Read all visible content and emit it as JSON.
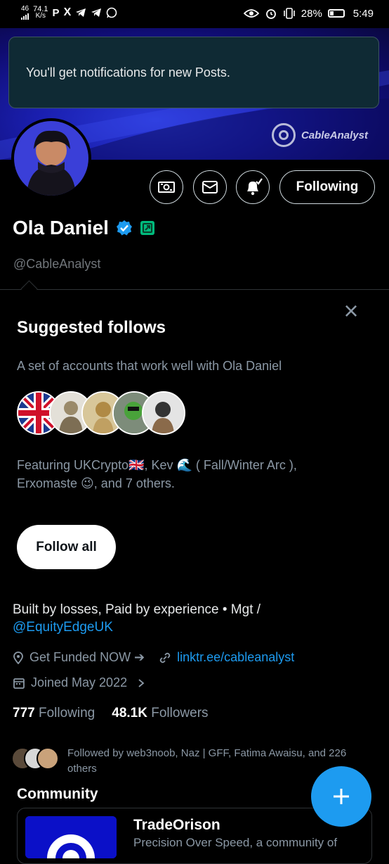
{
  "status_bar": {
    "network_top": "46",
    "network_bottom": "all",
    "speed_value": "74.1",
    "speed_unit": "K/s",
    "battery": "28%",
    "time": "5:49",
    "left_icons": [
      "signal-icon",
      "pinterest-icon",
      "x-icon",
      "telegram-icon",
      "telegram-icon",
      "telegram-icon",
      "whatsapp-icon"
    ],
    "right_icons": [
      "eye-icon",
      "alarm-icon",
      "vibrate-icon",
      "battery-icon"
    ]
  },
  "toast": {
    "message": "You'll get notifications for new Posts."
  },
  "banner": {
    "brand_text": "CableAnalyst"
  },
  "profile": {
    "name": "Ola Daniel",
    "handle": "@CableAnalyst",
    "following_button": "Following",
    "bio_text": "Built by losses, Paid by experience • Mgt /",
    "bio_mention": "@EquityEdgeUK",
    "location": "Get Funded NOW ➔",
    "website": "linktr.ee/cableanalyst",
    "joined": "Joined May 2022",
    "following_count": "777",
    "following_label": "Following",
    "followers_count": "48.1K",
    "followers_label": "Followers",
    "followed_by": "Followed by web3noob, Naz | GFF, Fatima Awaisu, and 226 others"
  },
  "suggested": {
    "title": "Suggested follows",
    "description": "A set of accounts that work well with Ola Daniel",
    "featuring_line1": "Featuring UKCrypto🇬🇧, Kev 🌊 ( Fall/Winter Arc ),",
    "featuring_line2": "Erxomaste 😉, and 7 others.",
    "follow_all": "Follow all"
  },
  "community": {
    "section_title": "Community",
    "name": "TradeOrison",
    "description": "Precision Over Speed, a community of"
  },
  "colors": {
    "accent": "#1d9bf0",
    "verified_badge": "#1d9bf0",
    "affiliate_badge": "#00ba7c"
  }
}
